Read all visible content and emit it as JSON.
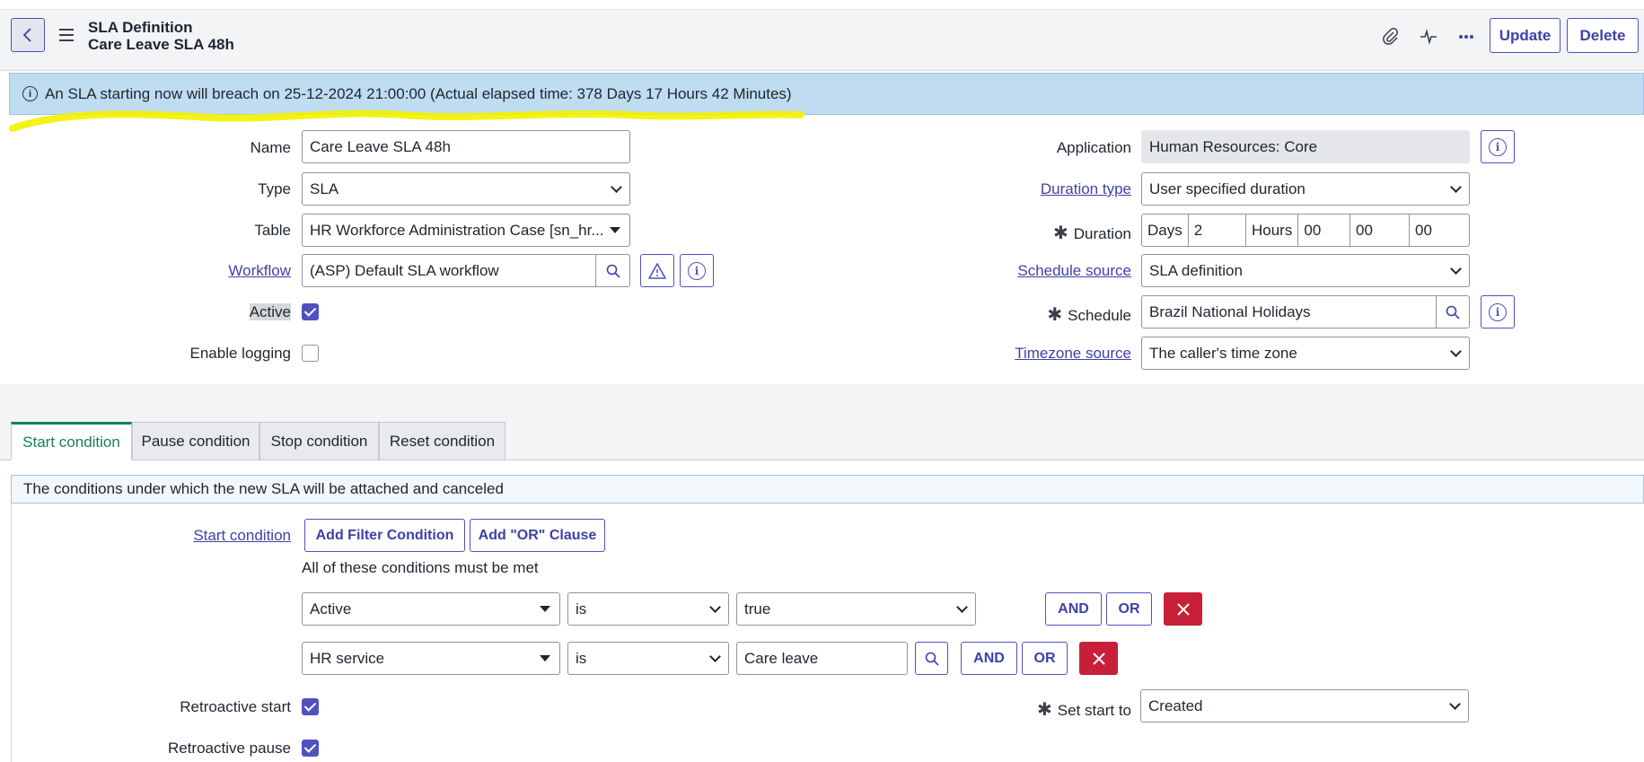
{
  "header": {
    "title": "SLA Definition",
    "subtitle": "Care Leave SLA 48h",
    "update_label": "Update",
    "delete_label": "Delete"
  },
  "banner": {
    "text": "An SLA starting now will breach on 25-12-2024 21:00:00 (Actual elapsed time: 378 Days 17 Hours 42 Minutes)",
    "highlight_color": "#f2f200"
  },
  "form": {
    "name_label": "Name",
    "name_value": "Care Leave SLA 48h",
    "type_label": "Type",
    "type_value": "SLA",
    "table_label": "Table",
    "table_value": "HR Workforce Administration Case [sn_hr...",
    "workflow_label": "Workflow",
    "workflow_value": "(ASP) Default SLA workflow",
    "active_label": "Active",
    "active_checked": true,
    "logging_label": "Enable logging",
    "logging_checked": false,
    "application_label": "Application",
    "application_value": "Human Resources: Core",
    "duration_type_label": "Duration type",
    "duration_type_value": "User specified duration",
    "duration_label": "Duration",
    "days_label": "Days",
    "days_value": "2",
    "hours_label": "Hours",
    "hours_value": "00",
    "minutes_value": "00",
    "seconds_value": "00",
    "schedule_source_label": "Schedule source",
    "schedule_source_value": "SLA definition",
    "schedule_label": "Schedule",
    "schedule_value": "Brazil National Holidays",
    "timezone_source_label": "Timezone source",
    "timezone_source_value": "The caller's time zone"
  },
  "tabs": [
    {
      "label": "Start condition",
      "active": true
    },
    {
      "label": "Pause condition",
      "active": false
    },
    {
      "label": "Stop condition",
      "active": false
    },
    {
      "label": "Reset condition",
      "active": false
    }
  ],
  "conditions": {
    "description": "The conditions under which the new SLA will be attached and canceled",
    "start_condition_label": "Start condition",
    "add_filter_label": "Add Filter Condition",
    "add_or_label": "Add \"OR\" Clause",
    "all_met_text": "All of these conditions must be met",
    "rows": [
      {
        "field": "Active",
        "operator": "is",
        "value": "true"
      },
      {
        "field": "HR service",
        "operator": "is",
        "value": "Care leave"
      }
    ],
    "and_label": "AND",
    "or_label": "OR",
    "retro_start_label": "Retroactive start",
    "retro_start_checked": true,
    "retro_pause_label": "Retroactive pause",
    "retro_pause_checked": true,
    "set_start_label": "Set start to",
    "set_start_value": "Created"
  },
  "colors": {
    "accent": "#4f52bd",
    "active_tab": "#1a7d5a",
    "banner_bg": "#bfdcf0",
    "remove_btn": "#c8203a"
  }
}
